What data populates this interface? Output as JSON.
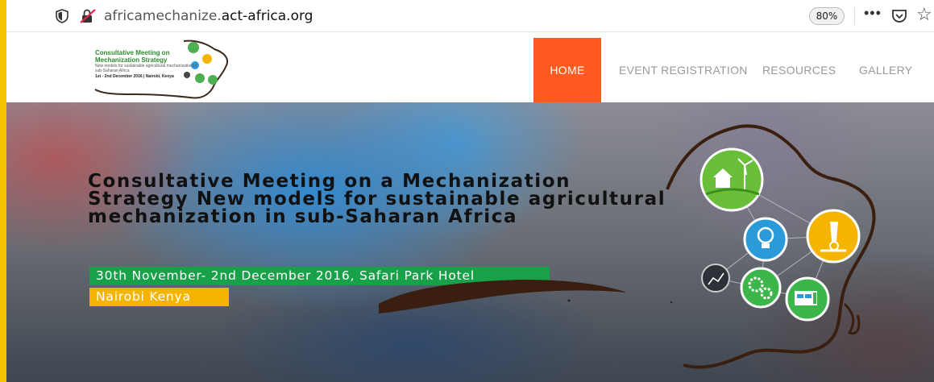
{
  "browser": {
    "url_prefix": "africamechanize.",
    "url_domain": "act-africa.org",
    "zoom": "80%",
    "more_label": "•••",
    "star_glyph": "☆"
  },
  "logo": {
    "title": "Consultative Meeting on Mechanization Strategy",
    "subtitle": "New models for sustainable agricultural mechanization in sub-Saharan Africa",
    "date": "1st - 2nd December 2016 | Nairobi, Kenya"
  },
  "nav": {
    "items": [
      {
        "label": "HOME",
        "active": true
      },
      {
        "label": "EVENT REGISTRATION",
        "active": false
      },
      {
        "label": "RESOURCES",
        "active": false
      },
      {
        "label": "GALLERY",
        "active": false
      }
    ]
  },
  "hero": {
    "title": "Consultative Meeting on a Mechanization Strategy New models for sustainable agricultural mechanization in sub-Saharan Africa",
    "date_line": "30th November- 2nd December 2016, Safari Park Hotel",
    "city_line": "Nairobi Kenya",
    "icons": [
      "farm-icon",
      "lightbulb-icon",
      "microscope-icon",
      "chart-icon",
      "gears-icon",
      "machine-icon"
    ]
  },
  "colors": {
    "active_nav": "#ff5a1f",
    "date_badge": "#19a14a",
    "city_badge": "#f5b400",
    "outer_border": "#f5c400"
  }
}
